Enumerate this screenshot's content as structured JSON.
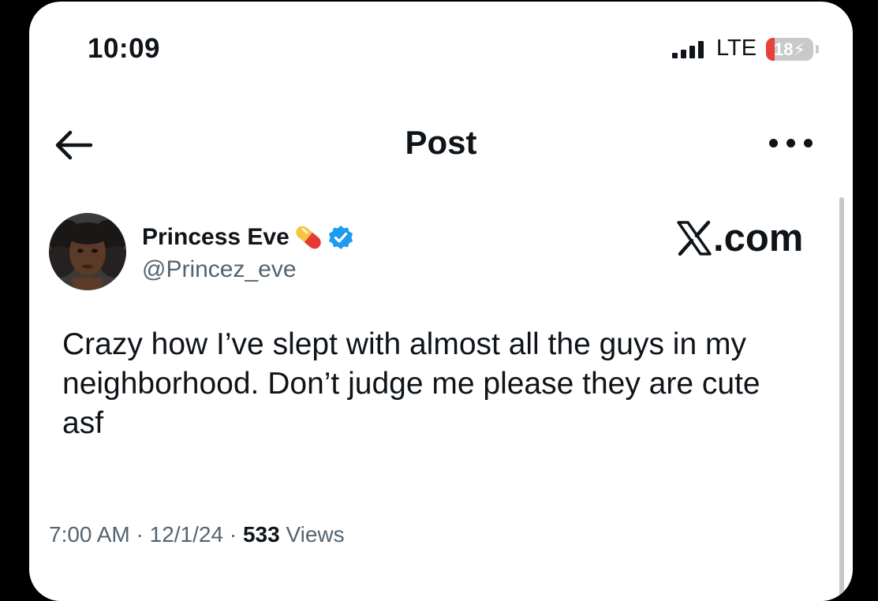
{
  "status_bar": {
    "time": "10:09",
    "network": "LTE",
    "battery_level": "18",
    "battery_fraction": 0.18
  },
  "nav": {
    "back_icon": "arrow-left-icon",
    "title": "Post",
    "more_icon": "more-horizontal-icon"
  },
  "post": {
    "author": {
      "display_name": "Princess Eve",
      "emoji_icon": "pill-icon",
      "verified_icon": "verified-badge-icon",
      "verified_color": "#1d9bf0",
      "handle": "@Princez_eve"
    },
    "brand": {
      "logo_icon": "x-logo-icon",
      "text": ".com"
    },
    "text": "Crazy how I’ve slept with almost all the guys in my neighborhood. Don’t judge me please they are cute asf",
    "time": "7:00 AM",
    "separator": "·",
    "date": "12/1/24",
    "views_count": "533",
    "views_label": "Views"
  },
  "colors": {
    "text_primary": "#0f1419",
    "text_secondary": "#536471",
    "battery_low": "#e8403a"
  }
}
